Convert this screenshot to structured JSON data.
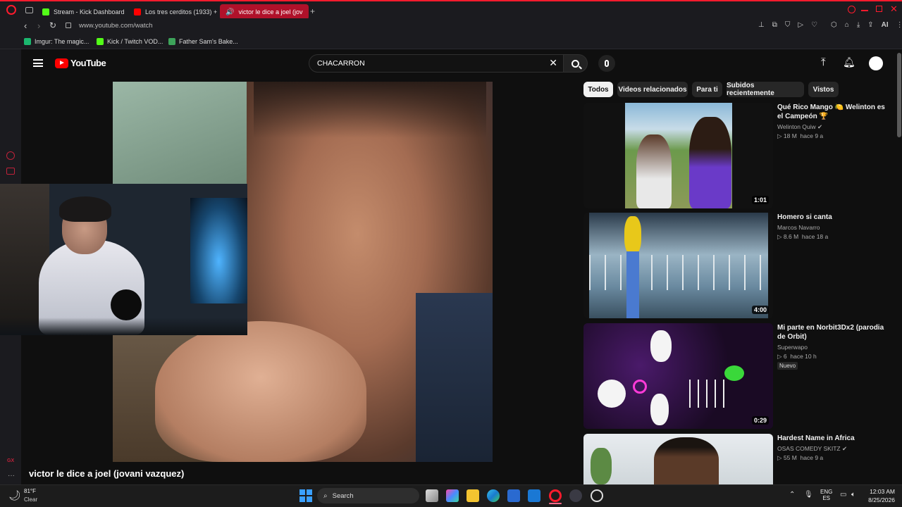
{
  "browser": {
    "tabs": [
      {
        "label": "Stream - Kick Dashboard",
        "icon": "kick-icon"
      },
      {
        "label": "Los tres cerditos (1933) + l",
        "icon": "youtube-icon"
      },
      {
        "label": "victor le dice a joel (jov",
        "icon": "speaker-icon"
      }
    ],
    "url": "www.youtube.com/watch",
    "bookmarks": [
      {
        "label": "Imgur: The magic..."
      },
      {
        "label": "Kick / Twitch VOD..."
      },
      {
        "label": "Father Sam's Bake..."
      }
    ],
    "ai_label": "AI"
  },
  "youtube": {
    "logo_text": "YouTube",
    "search_value": "CHACARRON",
    "chips": [
      "Todos",
      "Videos relacionados",
      "Para ti",
      "Subidos recientemente",
      "Vistos"
    ],
    "video_title": "victor le dice a joel (jovani vazquez)",
    "recommendations": [
      {
        "title": "Qué Rico Mango 🍋 Welinton es el Campeón 🏆",
        "channel": "Welinton Quiw",
        "views": "18 M",
        "age": "hace 9 a",
        "duration": "1:01",
        "verified": true
      },
      {
        "title": "Homero si canta",
        "channel": "Marcos Navarro",
        "views": "8.6 M",
        "age": "hace 18 a",
        "duration": "4:00",
        "verified": false
      },
      {
        "title": "Mi parte en Norbit3Dx2 (parodia de Orbit)",
        "channel": "Superwapo",
        "views": "6",
        "age": "hace 10 h",
        "duration": "0:29",
        "badge": "Nuevo",
        "verified": false
      },
      {
        "title": "Hardest Name in Africa",
        "channel": "OSAS COMEDY SKITZ",
        "views": "55 M",
        "age": "hace 9 a",
        "duration": "",
        "verified": true
      }
    ]
  },
  "taskbar": {
    "weather_temp": "81°F",
    "weather_desc": "Clear",
    "search_label": "Search",
    "lang_top": "ENG",
    "lang_bottom": "ES",
    "time": "12:03 AM",
    "date": "8/25/2026"
  },
  "colors": {
    "accent": "#ff1b2d",
    "yt_red": "#ff0000",
    "bg": "#0f0f0f"
  }
}
